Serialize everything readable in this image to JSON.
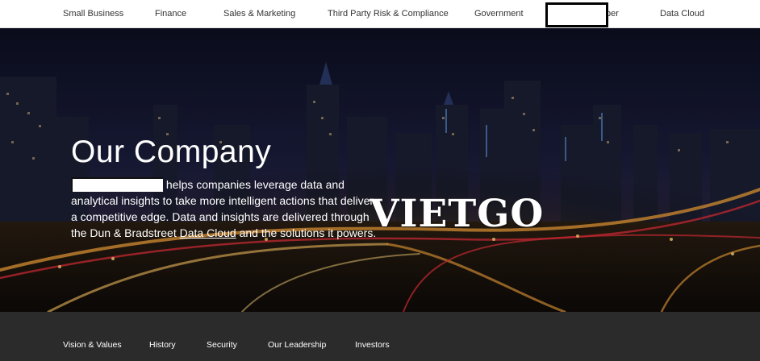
{
  "top_nav": {
    "items": [
      {
        "label": "Small Business"
      },
      {
        "label": "Finance"
      },
      {
        "label": "Sales & Marketing"
      },
      {
        "label": "Third Party Risk & Compliance"
      },
      {
        "label": "Government"
      },
      {
        "label": "per"
      },
      {
        "label": "Data Cloud"
      }
    ]
  },
  "hero": {
    "title": "Our Company",
    "lines": [
      " helps companies leverage data and",
      "analytical insights to take more intelligent actions that deliver",
      "a competitive edge. Data and insights are delivered through",
      "the Dun & Bradstreet "
    ],
    "link_text": "Data Cloud",
    "line4_suffix": " and the solutions it powers.",
    "watermark": "VIETGO"
  },
  "sub_nav": {
    "items": [
      {
        "label": "Vision & Values"
      },
      {
        "label": "History"
      },
      {
        "label": "Security"
      },
      {
        "label": "Our Leadership"
      },
      {
        "label": "Investors"
      }
    ]
  },
  "colors": {
    "subnav_bg": "#2b2b2b",
    "hero_sky": "#12142a",
    "light_orange": "#f2a33a",
    "light_red": "#e0303a"
  }
}
